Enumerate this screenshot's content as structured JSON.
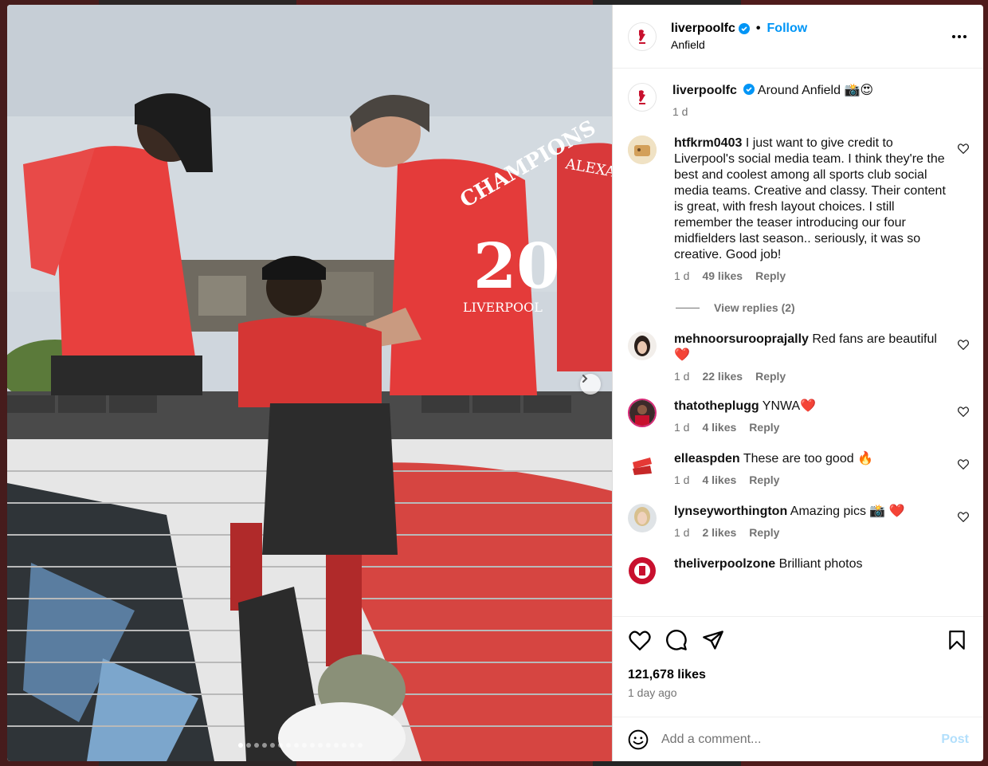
{
  "post": {
    "username": "liverpoolfc",
    "follow_label": "Follow",
    "separator": "•",
    "location": "Anfield",
    "caption_text": "Around Anfield 📸😍",
    "caption_time": "1 d"
  },
  "photo": {
    "shirt_text_1": "CHAMPIONS",
    "shirt_number": "20",
    "shirt_text_2": "LIVERPOOL",
    "shirt_text_3": "ALEXANDER-A",
    "total_slides": 16,
    "active_slide": 0
  },
  "comments": [
    {
      "user": "htfkrm0403",
      "text": "I just want to give credit to Liverpool's social media team. I think they're the best and coolest among all sports club social media teams. Creative and classy. Their content is great, with fresh layout choices. I still remember the teaser introducing our four midfielders last season.. seriously, it was so creative. Good job!",
      "time": "1 d",
      "likes": "49 likes",
      "reply": "Reply",
      "view_replies": "View replies (2)"
    },
    {
      "user": "mehnoorsurooprajally",
      "text": "Red fans are beautiful ❤️",
      "time": "1 d",
      "likes": "22 likes",
      "reply": "Reply"
    },
    {
      "user": "thatotheplugg",
      "text": "YNWA❤️",
      "time": "1 d",
      "likes": "4 likes",
      "reply": "Reply"
    },
    {
      "user": "elleaspden",
      "text": "These are too good 🔥",
      "time": "1 d",
      "likes": "4 likes",
      "reply": "Reply"
    },
    {
      "user": "lynseyworthington",
      "text": "Amazing pics 📸 ❤️",
      "time": "1 d",
      "likes": "2 likes",
      "reply": "Reply"
    },
    {
      "user": "theliverpoolzone",
      "text": "Brilliant photos"
    }
  ],
  "footer": {
    "likes_count": "121,678 likes",
    "time_ago": "1 day ago",
    "comment_placeholder": "Add a comment...",
    "post_label": "Post"
  },
  "colors": {
    "accent": "#0095f6",
    "lfc_red": "#c8102e",
    "muted": "#737373"
  }
}
